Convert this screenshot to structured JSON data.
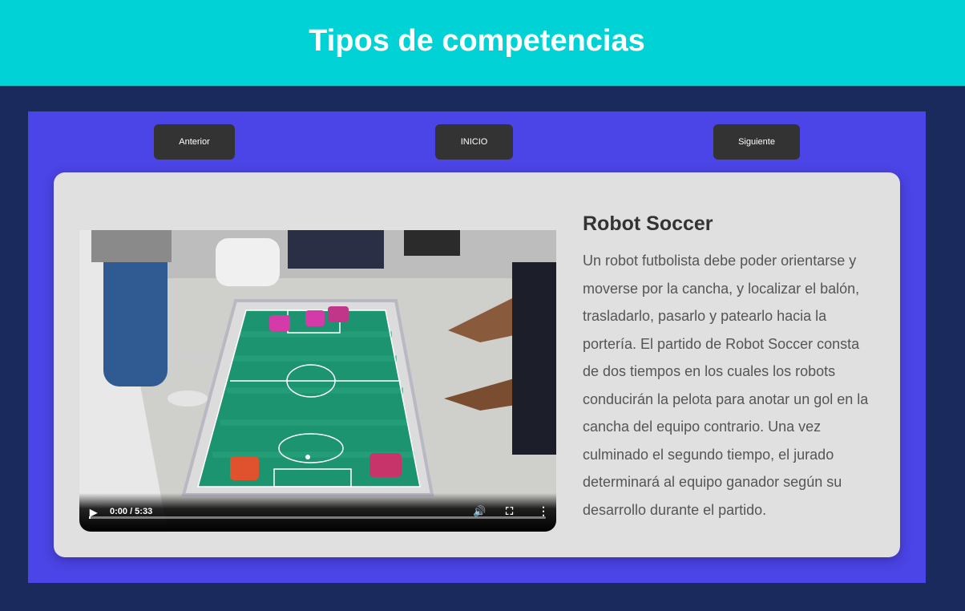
{
  "header": {
    "title": "Tipos de competencias"
  },
  "nav": {
    "prev_label": "Anterior",
    "home_label": "INICIO",
    "next_label": "Siguiente"
  },
  "content": {
    "title": "Robot Soccer",
    "description": "Un robot futbolista debe poder orientarse y moverse por la cancha, y localizar el balón, trasladarlo, pasarlo y patearlo hacia la portería. El partido de Robot Soccer consta de dos tiempos en los cuales los robots conducirán la pelota para anotar un gol en la cancha del equipo contrario. Una vez culminado el segundo tiempo, el jurado determinará al equipo ganador según su desarrollo durante el partido."
  },
  "video": {
    "time_display": "0:00 / 5:33",
    "progress_fraction": 0,
    "icons": [
      "play-icon",
      "volume-icon",
      "fullscreen-icon",
      "more-options-icon"
    ]
  },
  "colors": {
    "header_bg": "#00d2d6",
    "page_bg": "#1b2a5c",
    "panel_bg": "#4b44e6",
    "card_bg": "#e0e0e0",
    "button_bg": "#333333"
  }
}
